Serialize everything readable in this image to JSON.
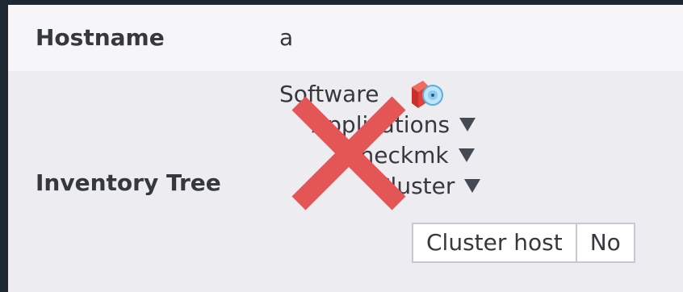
{
  "hostname_row": {
    "label": "Hostname",
    "value": "a"
  },
  "inventory_row": {
    "label": "Inventory Tree",
    "tree": {
      "software": "Software",
      "applications": "Applications",
      "checkmk": "Checkmk",
      "cluster": "Cluster"
    },
    "attributes": [
      {
        "key": "Cluster host",
        "value": "No"
      }
    ]
  },
  "icons": {
    "software": "software-package-icon",
    "toggle": "triangle-down-icon",
    "cross": "red-cross-icon"
  },
  "colors": {
    "cross": "#e45556",
    "row_header_bg": "#f6f6f9",
    "row_bg": "#ececf1",
    "text": "#35383d"
  }
}
